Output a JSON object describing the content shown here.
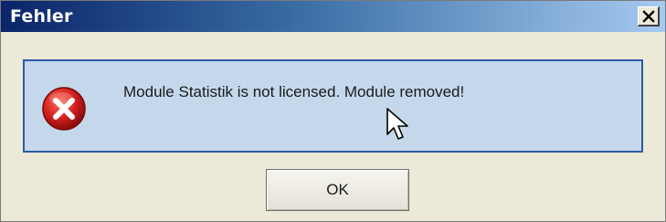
{
  "window": {
    "title": "Fehler",
    "close_label": "Close"
  },
  "dialog": {
    "icon": "error-icon",
    "message": "Module Statistik is not licensed. Module removed!",
    "ok_label": "OK"
  },
  "colors": {
    "titlebar_start": "#0a246a",
    "titlebar_end": "#a6caf0",
    "panel_background": "#c5d8eb",
    "panel_border": "#2b5aa4",
    "error_red": "#d21f1f"
  }
}
